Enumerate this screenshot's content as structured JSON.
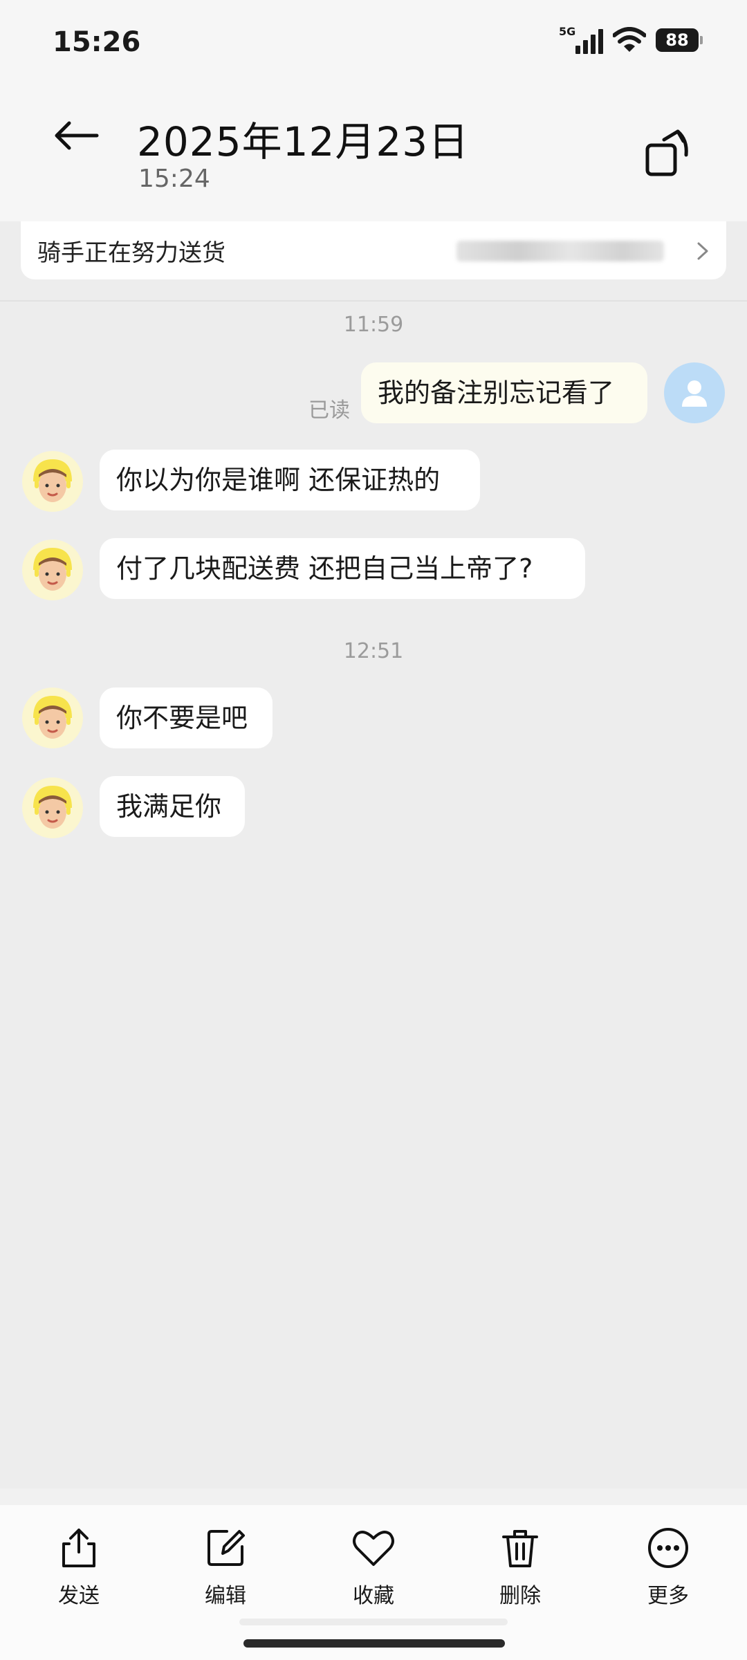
{
  "status_bar": {
    "time": "15:26",
    "network": "5G",
    "battery": "88"
  },
  "header": {
    "back_icon": "arrow-left-icon",
    "title": "2025年12月23日",
    "subtitle": "15:24",
    "rotate_icon": "rotate-icon"
  },
  "order_card": {
    "status_text": "骑手正在努力送货",
    "chevron_icon": "chevron-right-icon"
  },
  "chat": {
    "messages": [
      {
        "type": "time",
        "text": "11:59"
      },
      {
        "type": "outgoing",
        "text": "我的备注别忘记看了",
        "read_label": "已读",
        "avatar": "user-avatar-icon"
      },
      {
        "type": "incoming",
        "text": "你以为你是谁啊 还保证热的",
        "avatar": "rider-avatar"
      },
      {
        "type": "incoming",
        "text": "付了几块配送费 还把自己当上帝了?",
        "avatar": "rider-avatar"
      },
      {
        "type": "time",
        "text": "12:51"
      },
      {
        "type": "incoming",
        "text": "你不要是吧",
        "avatar": "rider-avatar"
      },
      {
        "type": "incoming",
        "text": "我满足你",
        "avatar": "rider-avatar"
      }
    ]
  },
  "toolbar": {
    "items": [
      {
        "label": "发送",
        "icon": "share-icon"
      },
      {
        "label": "编辑",
        "icon": "edit-icon"
      },
      {
        "label": "收藏",
        "icon": "heart-icon"
      },
      {
        "label": "删除",
        "icon": "trash-icon"
      },
      {
        "label": "更多",
        "icon": "more-icon"
      }
    ]
  },
  "colors": {
    "chat_background": "#ededed",
    "outgoing_bubble": "#fdfcef",
    "incoming_bubble": "#ffffff",
    "self_avatar": "#bcdcf7",
    "rider_avatar_helmet": "#f7e34c"
  }
}
